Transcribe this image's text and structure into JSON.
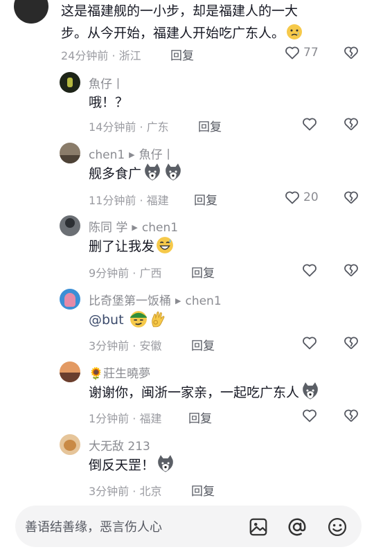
{
  "top_comment": {
    "text_line1": "这是福建舰的一小步，却是福建人的一大",
    "text_line2": "步。从今开始，福建人开始吃广东人。",
    "time": "24分钟前 · 浙江",
    "reply": "回复",
    "likes": "77"
  },
  "replies": [
    {
      "user": "魚仔丨",
      "to": "",
      "text": "哦！？",
      "time": "14分钟前 · 广东",
      "reply": "回复",
      "likes": ""
    },
    {
      "user": "chen1",
      "to": "魚仔丨",
      "text": "舰多食广",
      "time": "11分钟前 · 福建",
      "reply": "回复",
      "likes": "20"
    },
    {
      "user": "陈同 学",
      "to": "chen1",
      "text": "删了让我发",
      "time": "9分钟前 · 广西",
      "reply": "回复",
      "likes": ""
    },
    {
      "user": "比奇堡第一饭桶",
      "to": "chen1",
      "text": "@but",
      "time": "3分钟前 · 安徽",
      "reply": "回复",
      "likes": ""
    },
    {
      "user": "🌻莊生曉夢",
      "to": "",
      "text": "谢谢你，闽浙一家亲，一起吃广东人",
      "time": "1分钟前 · 福建",
      "reply": "回复",
      "likes": ""
    },
    {
      "user": "大无敌 213",
      "to": "",
      "text": "倒反天罡！",
      "time": "3分钟前 · 北京",
      "reply": "回复",
      "likes": ""
    }
  ],
  "input": {
    "placeholder": "善语结善缘，恶言伤人心"
  },
  "icons": {
    "like": "heart-outline-icon",
    "dislike": "broken-heart-icon",
    "image": "image-icon",
    "mention": "at-icon",
    "emoji": "emoji-icon"
  },
  "colors": {
    "text": "#161823",
    "meta": "#9a9ba1",
    "background": "#ffffff"
  }
}
